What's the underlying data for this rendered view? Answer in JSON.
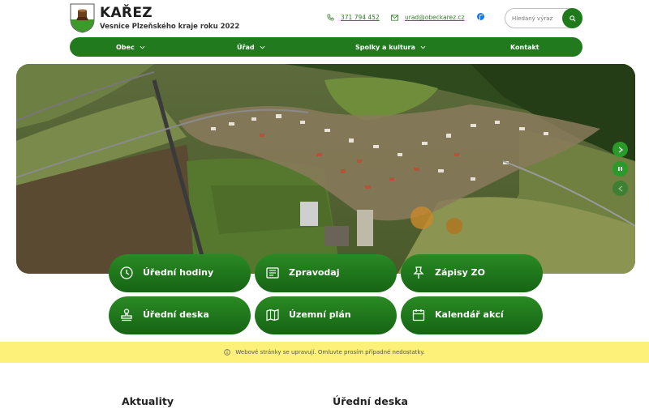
{
  "header": {
    "title": "KAŘEZ",
    "subtitle": "Vesnice Plzeňského kraje roku 2022",
    "phone": "371 794 452",
    "email": "urad@obeckarez.cz",
    "search_placeholder": "Hledaný výraz"
  },
  "nav": {
    "items": [
      {
        "label": "Obec"
      },
      {
        "label": "Úřad"
      },
      {
        "label": "Spolky a kultura"
      },
      {
        "label": "Kontakt"
      }
    ]
  },
  "tiles": [
    {
      "label": "Úřední hodiny",
      "icon": "clock-icon"
    },
    {
      "label": "Zpravodaj",
      "icon": "newspaper-icon"
    },
    {
      "label": "Zápisy ZO",
      "icon": "pin-icon"
    },
    {
      "label": "Úřední deska",
      "icon": "stamp-icon"
    },
    {
      "label": "Územní plán",
      "icon": "map-icon"
    },
    {
      "label": "Kalendář akcí",
      "icon": "calendar-icon"
    }
  ],
  "notice": "Webové stránky se upravují. Omluvte prosím případné nedostatky.",
  "sections": {
    "news_title": "Aktuality",
    "board_title": "Úřední deska"
  },
  "colors": {
    "brand_green": "#217a1e",
    "notice_yellow": "#fdf17a"
  }
}
